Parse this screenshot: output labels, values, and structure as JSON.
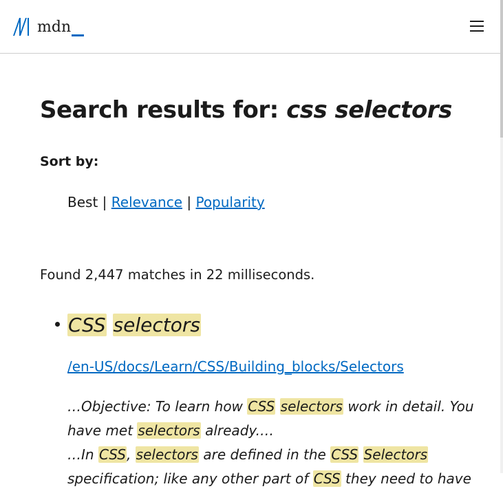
{
  "header": {
    "logo_text": "mdn_",
    "menu_icon": "hamburger-icon"
  },
  "search": {
    "title_prefix": "Search results for: ",
    "query": "css selectors"
  },
  "sort": {
    "label": "Sort by:",
    "best": "Best",
    "separator": "|",
    "relevance": "Relevance",
    "popularity": "Popularity"
  },
  "found_text": "Found 2,447 matches in 22 milliseconds.",
  "result": {
    "title_word1": "CSS",
    "title_word2": "selectors",
    "url": "/en-US/docs/Learn/CSS/Building_blocks/Selectors",
    "excerpt": {
      "l1_a": "…Objective: To learn how ",
      "l1_m1": "CSS",
      "l1_m2": "selectors",
      "l1_b": " work in detail. You",
      "l2_a": "have met ",
      "l2_m1": "selectors",
      "l2_b": " already.…",
      "l3_a": "…In ",
      "l3_m1": "CSS",
      "l3_b": ", ",
      "l3_m2": "selectors",
      "l3_c": " are defined in the ",
      "l3_m3": "CSS",
      "l3_m4": "Selectors",
      "l4_a": "specification; like any other part of ",
      "l4_m1": "CSS",
      "l4_b": " they need to have"
    }
  },
  "colors": {
    "link": "#0069c2",
    "highlight": "#efe5a3",
    "text": "#1b1b1b",
    "border": "#cdcdcd"
  }
}
